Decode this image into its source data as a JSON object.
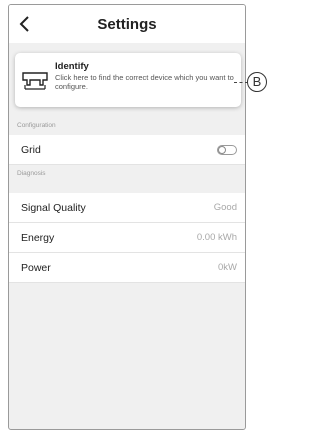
{
  "header": {
    "title": "Settings"
  },
  "identify_card": {
    "title": "Identify",
    "description": "Click here to find the correct device which you want to configure."
  },
  "sections": {
    "configuration": "Configuration",
    "diagnosis": "Diagnosis"
  },
  "configuration": {
    "grid_label": "Grid",
    "grid_toggle_on": false
  },
  "diagnosis": {
    "signal_quality_label": "Signal Quality",
    "signal_quality_value": "Good",
    "energy_label": "Energy",
    "energy_value": "0.00 kWh",
    "power_label": "Power",
    "power_value": "0kW"
  },
  "callout": {
    "label": "B"
  }
}
